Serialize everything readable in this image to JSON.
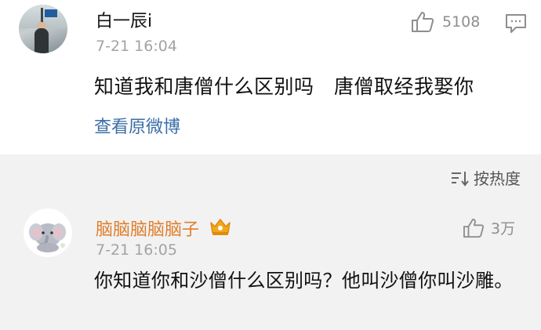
{
  "post": {
    "username": "白一辰i",
    "time": "7-21 16:04",
    "like_count": "5108",
    "text": "知道我和唐僧什么区别吗　唐僧取经我娶你",
    "view_original": "查看原微博"
  },
  "sort": {
    "label": "按热度"
  },
  "comment": {
    "username": "脑脑脑脑脑子",
    "time": "7-21 16:05",
    "like_count": "3万",
    "text": "你知道你和沙僧什么区别吗？他叫沙僧你叫沙雕。"
  },
  "colors": {
    "username_highlight": "#e07f2c",
    "link": "#3b6fa8",
    "muted": "#a3a3a3",
    "section_bg": "#f2f2f2"
  },
  "icons": [
    "thumbs-up-icon",
    "comment-icon",
    "sort-icon",
    "crown-icon",
    "elephant-avatar"
  ]
}
